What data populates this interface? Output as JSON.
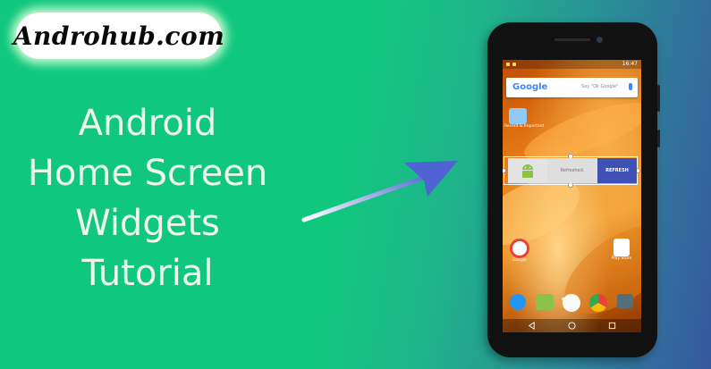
{
  "brand": {
    "logo_text": "Androhub.com"
  },
  "headline": [
    "Android",
    "Home Screen",
    "Widgets",
    "Tutorial"
  ],
  "phone": {
    "status_time": "16:47",
    "search_brand": "Google",
    "search_hint": "Say \"Ok Google\"",
    "folder_label": "Recent & Important",
    "widget": {
      "status": "Refreshed.",
      "button": "REFRESH"
    },
    "apps": [
      {
        "label": "Google",
        "icon": "google-icon"
      },
      {
        "label": "Play Store",
        "icon": "play-store-icon"
      }
    ],
    "dock": [
      "phone-icon",
      "messages-icon",
      "app-drawer-icon",
      "chrome-icon",
      "camera-icon"
    ],
    "nav": [
      "back-icon",
      "home-icon",
      "recents-icon"
    ]
  },
  "colors": {
    "background_start": "#10c77e",
    "background_end": "#3758a0",
    "widget_button": "#3f51b5"
  }
}
